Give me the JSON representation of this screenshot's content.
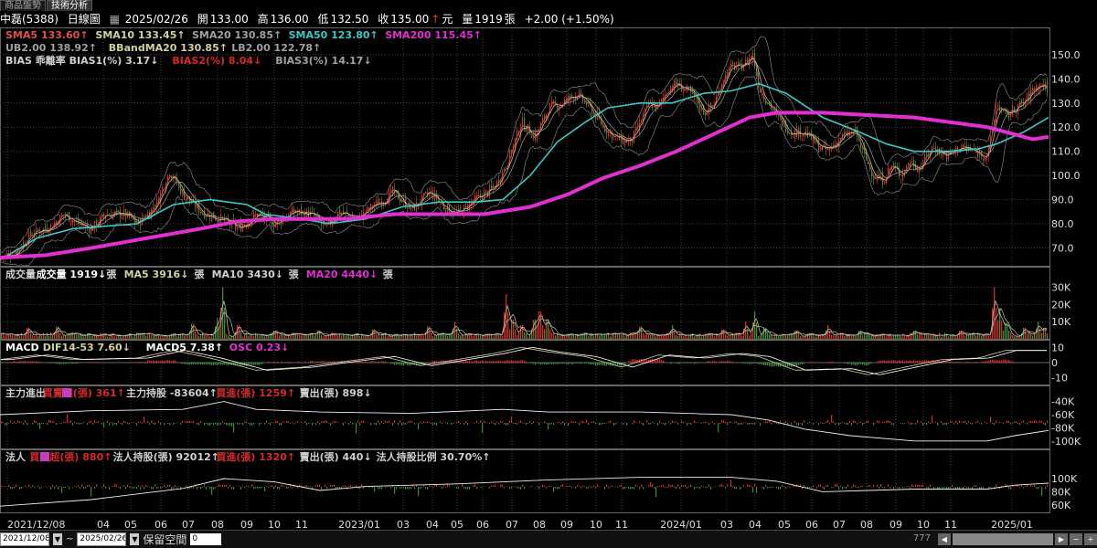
{
  "tabs": [
    {
      "label": "商品盤勢"
    },
    {
      "label": "技術分析"
    }
  ],
  "header": {
    "stock": "中磊(5388)",
    "chart_type": "日線圖",
    "date": "2025/02/26",
    "open_label": "開",
    "open": "133.00",
    "high_label": "高",
    "high": "136.00",
    "low_label": "低",
    "low": "132.50",
    "close_label": "收",
    "close": "135.00",
    "unit": "元",
    "vol_label": "量",
    "vol": "1919",
    "vol_unit": "張",
    "change": "+2.00 (+1.50%)"
  },
  "colors": {
    "up": "#d42a2a",
    "down": "#3c8a3c",
    "sma5": "#e05050",
    "sma10": "#d0d0a0",
    "sma20": "#a0a0a0",
    "sma50": "#3cc8c8",
    "sma200": "#e030d0",
    "bb": "#808080",
    "white": "#ffffff",
    "cyan": "#40e0e0",
    "grid": "#404040"
  },
  "price_panel": {
    "legend1": [
      {
        "label": "SMA5 133.60",
        "color": "#e05050",
        "arrow": "up"
      },
      {
        "label": "SMA10 133.45",
        "color": "#d0d0a0",
        "arrow": "up"
      },
      {
        "label": "SMA20 130.85",
        "color": "#a0a0a0",
        "arrow": "up"
      },
      {
        "label": "SMA50 123.80",
        "color": "#3cc8c8",
        "arrow": "up"
      },
      {
        "label": "SMA200 115.45",
        "color": "#e030d0",
        "arrow": "up"
      }
    ],
    "legend2": [
      {
        "label": "UB2.00 138.92",
        "color": "#a0a0a0",
        "arrow": "up"
      },
      {
        "label": "BBandMA20 130.85",
        "color": "#d0d0a0",
        "arrow": "up"
      },
      {
        "label": "LB2.00 122.78",
        "color": "#a0a0a0",
        "arrow": "up"
      }
    ],
    "legend3": [
      {
        "label": "BIAS 乖離率",
        "color": "#d0d0d0",
        "arrow": ""
      },
      {
        "label": "BIAS1(%) 3.17",
        "color": "#d0d0d0",
        "arrow": "down"
      },
      {
        "label": "BIAS2(%) 8.04",
        "color": "#d42a2a",
        "arrow": "down"
      },
      {
        "label": "BIAS3(%) 14.17",
        "color": "#a0a0a0",
        "arrow": "down"
      }
    ]
  },
  "volume_panel": {
    "legend": [
      {
        "label": "成交量",
        "color": "#d0d0d0",
        "arrow": ""
      },
      {
        "label": "成交量 1919",
        "color": "#ffffff",
        "arrow": "down"
      },
      {
        "label": "張",
        "color": "#d0d0d0",
        "arrow": ""
      },
      {
        "label": "MA5 3916",
        "color": "#d0d0a0",
        "arrow": "down"
      },
      {
        "label": "張",
        "color": "#d0d0d0",
        "arrow": ""
      },
      {
        "label": "MA10 3430",
        "color": "#d0d0d0",
        "arrow": "down"
      },
      {
        "label": "張",
        "color": "#d0d0d0",
        "arrow": ""
      },
      {
        "label": "MA20 4440",
        "color": "#e030d0",
        "arrow": "down"
      },
      {
        "label": "張",
        "color": "#d0d0d0",
        "arrow": ""
      }
    ]
  },
  "macd_panel": {
    "legend": [
      {
        "label": "MACD",
        "color": "#ffffff",
        "arrow": ""
      },
      {
        "label": "DIF14-53 7.60",
        "color": "#d0d0a0",
        "arrow": "down"
      },
      {
        "label": "MACD5 7.38",
        "color": "#ffffff",
        "arrow": "up"
      },
      {
        "label": "OSC 0.23",
        "color": "#e030d0",
        "arrow": "down"
      }
    ]
  },
  "main_force_panel": {
    "legend": [
      {
        "label": "主力進出",
        "color": "#d0d0d0",
        "arrow": ""
      },
      {
        "label": "買賣超(張) 361",
        "color": "#d42a2a",
        "arrow": "up"
      },
      {
        "label": "主力持股 -83604",
        "color": "#d0d0d0",
        "arrow": "up"
      },
      {
        "label": "買進(張) 1259",
        "color": "#d42a2a",
        "arrow": "up"
      },
      {
        "label": "賣出(張) 898",
        "color": "#d0d0d0",
        "arrow": "down"
      }
    ]
  },
  "institutional_panel": {
    "legend": [
      {
        "label": "法人",
        "color": "#d0d0d0",
        "arrow": ""
      },
      {
        "label": "買賣超(張) 880",
        "color": "#d42a2a",
        "arrow": "up"
      },
      {
        "label": "法人持股(張) 92012",
        "color": "#d0d0d0",
        "arrow": "up"
      },
      {
        "label": "買進(張) 1320",
        "color": "#d42a2a",
        "arrow": "up"
      },
      {
        "label": "賣出(張) 440",
        "color": "#d0d0d0",
        "arrow": "down"
      },
      {
        "label": "法人持股比例 30.70%",
        "color": "#d0d0d0",
        "arrow": "up"
      }
    ]
  },
  "x_axis": {
    "ticks": [
      "2021/12/08",
      "04",
      "05",
      "06",
      "07",
      "08",
      "09",
      "10",
      "11",
      "2023/01",
      "03",
      "04",
      "05",
      "06",
      "07",
      "08",
      "09",
      "10",
      "11",
      "2024/01",
      "03",
      "04",
      "05",
      "06",
      "07",
      "08",
      "09",
      "10",
      "11",
      "2025/01"
    ]
  },
  "bottom": {
    "from_date": "2021/12/08",
    "tilde": "~",
    "to_date": "2025/02/26",
    "keep_space": "保留空間",
    "space_value": "0",
    "extra": "777"
  },
  "chart_data": [
    {
      "type": "candlestick",
      "ylim": [
        63,
        156
      ],
      "ticks": [
        70,
        80,
        90,
        100,
        110,
        120,
        130,
        140,
        150
      ],
      "anchors_close": [
        [
          0,
          66
        ],
        [
          15,
          68
        ],
        [
          35,
          76
        ],
        [
          55,
          79
        ],
        [
          70,
          84
        ],
        [
          85,
          80
        ],
        [
          100,
          78
        ],
        [
          115,
          84
        ],
        [
          135,
          84
        ],
        [
          150,
          80
        ],
        [
          170,
          88
        ],
        [
          185,
          102
        ],
        [
          200,
          92
        ],
        [
          220,
          85
        ],
        [
          240,
          82
        ],
        [
          260,
          78
        ],
        [
          280,
          84
        ],
        [
          300,
          80
        ],
        [
          320,
          85
        ],
        [
          340,
          84
        ],
        [
          355,
          78
        ],
        [
          370,
          85
        ],
        [
          390,
          82
        ],
        [
          410,
          88
        ],
        [
          430,
          93
        ],
        [
          450,
          86
        ],
        [
          470,
          93
        ],
        [
          485,
          87
        ],
        [
          500,
          84
        ],
        [
          520,
          90
        ],
        [
          540,
          95
        ],
        [
          555,
          106
        ],
        [
          570,
          122
        ],
        [
          585,
          116
        ],
        [
          600,
          128
        ],
        [
          615,
          130
        ],
        [
          630,
          134
        ],
        [
          645,
          128
        ],
        [
          660,
          120
        ],
        [
          675,
          115
        ],
        [
          690,
          114
        ],
        [
          700,
          122
        ],
        [
          710,
          130
        ],
        [
          720,
          128
        ],
        [
          730,
          136
        ],
        [
          740,
          138
        ],
        [
          750,
          135
        ],
        [
          760,
          132
        ],
        [
          770,
          126
        ],
        [
          780,
          129
        ],
        [
          790,
          140
        ],
        [
          800,
          145
        ],
        [
          810,
          145
        ],
        [
          818,
          148
        ],
        [
          823,
          150
        ],
        [
          830,
          136
        ],
        [
          840,
          130
        ],
        [
          850,
          124
        ],
        [
          865,
          118
        ],
        [
          880,
          118
        ],
        [
          895,
          112
        ],
        [
          905,
          110
        ],
        [
          920,
          116
        ],
        [
          935,
          118
        ],
        [
          945,
          108
        ],
        [
          955,
          100
        ],
        [
          965,
          98
        ],
        [
          975,
          104
        ],
        [
          985,
          100
        ],
        [
          995,
          106
        ],
        [
          1005,
          103
        ],
        [
          1020,
          112
        ],
        [
          1035,
          108
        ],
        [
          1050,
          112
        ],
        [
          1065,
          110
        ],
        [
          1080,
          108
        ],
        [
          1090,
          130
        ],
        [
          1100,
          124
        ],
        [
          1110,
          128
        ],
        [
          1120,
          130
        ],
        [
          1130,
          136
        ],
        [
          1140,
          138
        ],
        [
          1147,
          135
        ]
      ],
      "sma50": [
        [
          0,
          65
        ],
        [
          40,
          74
        ],
        [
          80,
          78
        ],
        [
          150,
          80
        ],
        [
          190,
          88
        ],
        [
          230,
          90
        ],
        [
          270,
          88
        ],
        [
          290,
          84
        ],
        [
          330,
          82
        ],
        [
          360,
          80
        ],
        [
          400,
          82
        ],
        [
          440,
          87
        ],
        [
          480,
          89
        ],
        [
          520,
          89
        ],
        [
          550,
          90
        ],
        [
          580,
          100
        ],
        [
          610,
          114
        ],
        [
          640,
          122
        ],
        [
          665,
          128
        ],
        [
          700,
          130
        ],
        [
          735,
          130
        ],
        [
          770,
          134
        ],
        [
          800,
          135
        ],
        [
          830,
          138
        ],
        [
          860,
          134
        ],
        [
          900,
          124
        ],
        [
          940,
          118
        ],
        [
          970,
          113
        ],
        [
          1000,
          110
        ],
        [
          1040,
          110
        ],
        [
          1070,
          111
        ],
        [
          1090,
          113
        ],
        [
          1120,
          118
        ],
        [
          1147,
          124
        ]
      ],
      "sma200": [
        [
          0,
          66
        ],
        [
          50,
          67
        ],
        [
          100,
          70
        ],
        [
          160,
          74
        ],
        [
          220,
          78
        ],
        [
          260,
          81
        ],
        [
          300,
          82
        ],
        [
          340,
          82
        ],
        [
          380,
          82
        ],
        [
          430,
          84
        ],
        [
          480,
          84
        ],
        [
          530,
          84
        ],
        [
          580,
          87
        ],
        [
          620,
          92
        ],
        [
          660,
          99
        ],
        [
          700,
          104
        ],
        [
          740,
          110
        ],
        [
          780,
          117
        ],
        [
          820,
          124
        ],
        [
          850,
          126
        ],
        [
          900,
          126
        ],
        [
          950,
          125
        ],
        [
          1000,
          124
        ],
        [
          1040,
          122
        ],
        [
          1080,
          120
        ],
        [
          1110,
          117
        ],
        [
          1130,
          115
        ],
        [
          1147,
          116
        ]
      ]
    },
    {
      "type": "bar",
      "name": "成交量",
      "ticks": [
        {
          "label": "30K",
          "v": 30000
        },
        {
          "label": "20K",
          "v": 20000
        },
        {
          "label": "10K",
          "v": 10000
        }
      ],
      "ylim": [
        0,
        34000
      ],
      "spikes": [
        [
          30,
          8000
        ],
        [
          62,
          9000
        ],
        [
          210,
          11000
        ],
        [
          237,
          12000
        ],
        [
          243,
          30000
        ],
        [
          260,
          10000
        ],
        [
          300,
          6000
        ],
        [
          348,
          6000
        ],
        [
          408,
          7000
        ],
        [
          468,
          9000
        ],
        [
          497,
          10000
        ],
        [
          553,
          26000
        ],
        [
          560,
          14000
        ],
        [
          570,
          10000
        ],
        [
          584,
          14000
        ],
        [
          590,
          20000
        ],
        [
          598,
          14000
        ],
        [
          700,
          9000
        ],
        [
          735,
          8000
        ],
        [
          790,
          7000
        ],
        [
          815,
          10000
        ],
        [
          825,
          16000
        ],
        [
          836,
          8000
        ],
        [
          870,
          6000
        ],
        [
          905,
          8000
        ],
        [
          940,
          6000
        ],
        [
          1000,
          6000
        ],
        [
          1050,
          6000
        ],
        [
          1087,
          30000
        ],
        [
          1093,
          18000
        ],
        [
          1100,
          12000
        ],
        [
          1120,
          8000
        ],
        [
          1135,
          10000
        ],
        [
          1142,
          8000
        ]
      ]
    },
    {
      "type": "bar",
      "name": "MACD",
      "ticks": [
        {
          "label": "10",
          "v": 10
        },
        {
          "label": "0",
          "v": 0
        },
        {
          "label": "-10",
          "v": -10
        }
      ],
      "ylim": [
        -15,
        15
      ],
      "dif": [
        [
          0,
          2
        ],
        [
          40,
          5
        ],
        [
          80,
          2
        ],
        [
          150,
          3
        ],
        [
          190,
          8
        ],
        [
          230,
          3
        ],
        [
          280,
          -5
        ],
        [
          330,
          -3
        ],
        [
          380,
          1
        ],
        [
          420,
          4
        ],
        [
          460,
          -2
        ],
        [
          500,
          2
        ],
        [
          540,
          6
        ],
        [
          570,
          10
        ],
        [
          600,
          7
        ],
        [
          640,
          4
        ],
        [
          680,
          -3
        ],
        [
          720,
          5
        ],
        [
          760,
          3
        ],
        [
          800,
          6
        ],
        [
          830,
          4
        ],
        [
          870,
          -5
        ],
        [
          920,
          -4
        ],
        [
          950,
          -8
        ],
        [
          990,
          -3
        ],
        [
          1030,
          2
        ],
        [
          1070,
          3
        ],
        [
          1100,
          8
        ],
        [
          1147,
          8
        ]
      ]
    },
    {
      "type": "bar",
      "name": "主力進出",
      "ticks": [
        {
          "label": "-40K",
          "v": -40000
        },
        {
          "label": "-60K",
          "v": -60000
        },
        {
          "label": "-80K",
          "v": -80000
        },
        {
          "label": "-100K",
          "v": -100000
        }
      ],
      "ylim": [
        -110000,
        -35000
      ],
      "line": [
        [
          0,
          -60000
        ],
        [
          100,
          -54000
        ],
        [
          200,
          -52000
        ],
        [
          245,
          -40000
        ],
        [
          280,
          -52000
        ],
        [
          350,
          -56000
        ],
        [
          450,
          -58000
        ],
        [
          550,
          -52000
        ],
        [
          600,
          -56000
        ],
        [
          700,
          -56000
        ],
        [
          800,
          -60000
        ],
        [
          840,
          -68000
        ],
        [
          880,
          -82000
        ],
        [
          930,
          -92000
        ],
        [
          1000,
          -100000
        ],
        [
          1080,
          -100000
        ],
        [
          1110,
          -92000
        ],
        [
          1147,
          -84000
        ]
      ]
    },
    {
      "type": "bar",
      "name": "法人",
      "ticks": [
        {
          "label": "100K",
          "v": 100000
        },
        {
          "label": "80K",
          "v": 80000
        },
        {
          "label": "60K",
          "v": 60000
        }
      ],
      "ylim": [
        50000,
        125000
      ],
      "line": [
        [
          0,
          58000
        ],
        [
          100,
          68000
        ],
        [
          200,
          85000
        ],
        [
          245,
          100000
        ],
        [
          300,
          95000
        ],
        [
          350,
          82000
        ],
        [
          400,
          88000
        ],
        [
          500,
          92000
        ],
        [
          600,
          98000
        ],
        [
          700,
          102000
        ],
        [
          800,
          102000
        ],
        [
          850,
          96000
        ],
        [
          900,
          80000
        ],
        [
          950,
          82000
        ],
        [
          1000,
          84000
        ],
        [
          1080,
          84000
        ],
        [
          1110,
          90000
        ],
        [
          1147,
          93000
        ]
      ]
    }
  ]
}
